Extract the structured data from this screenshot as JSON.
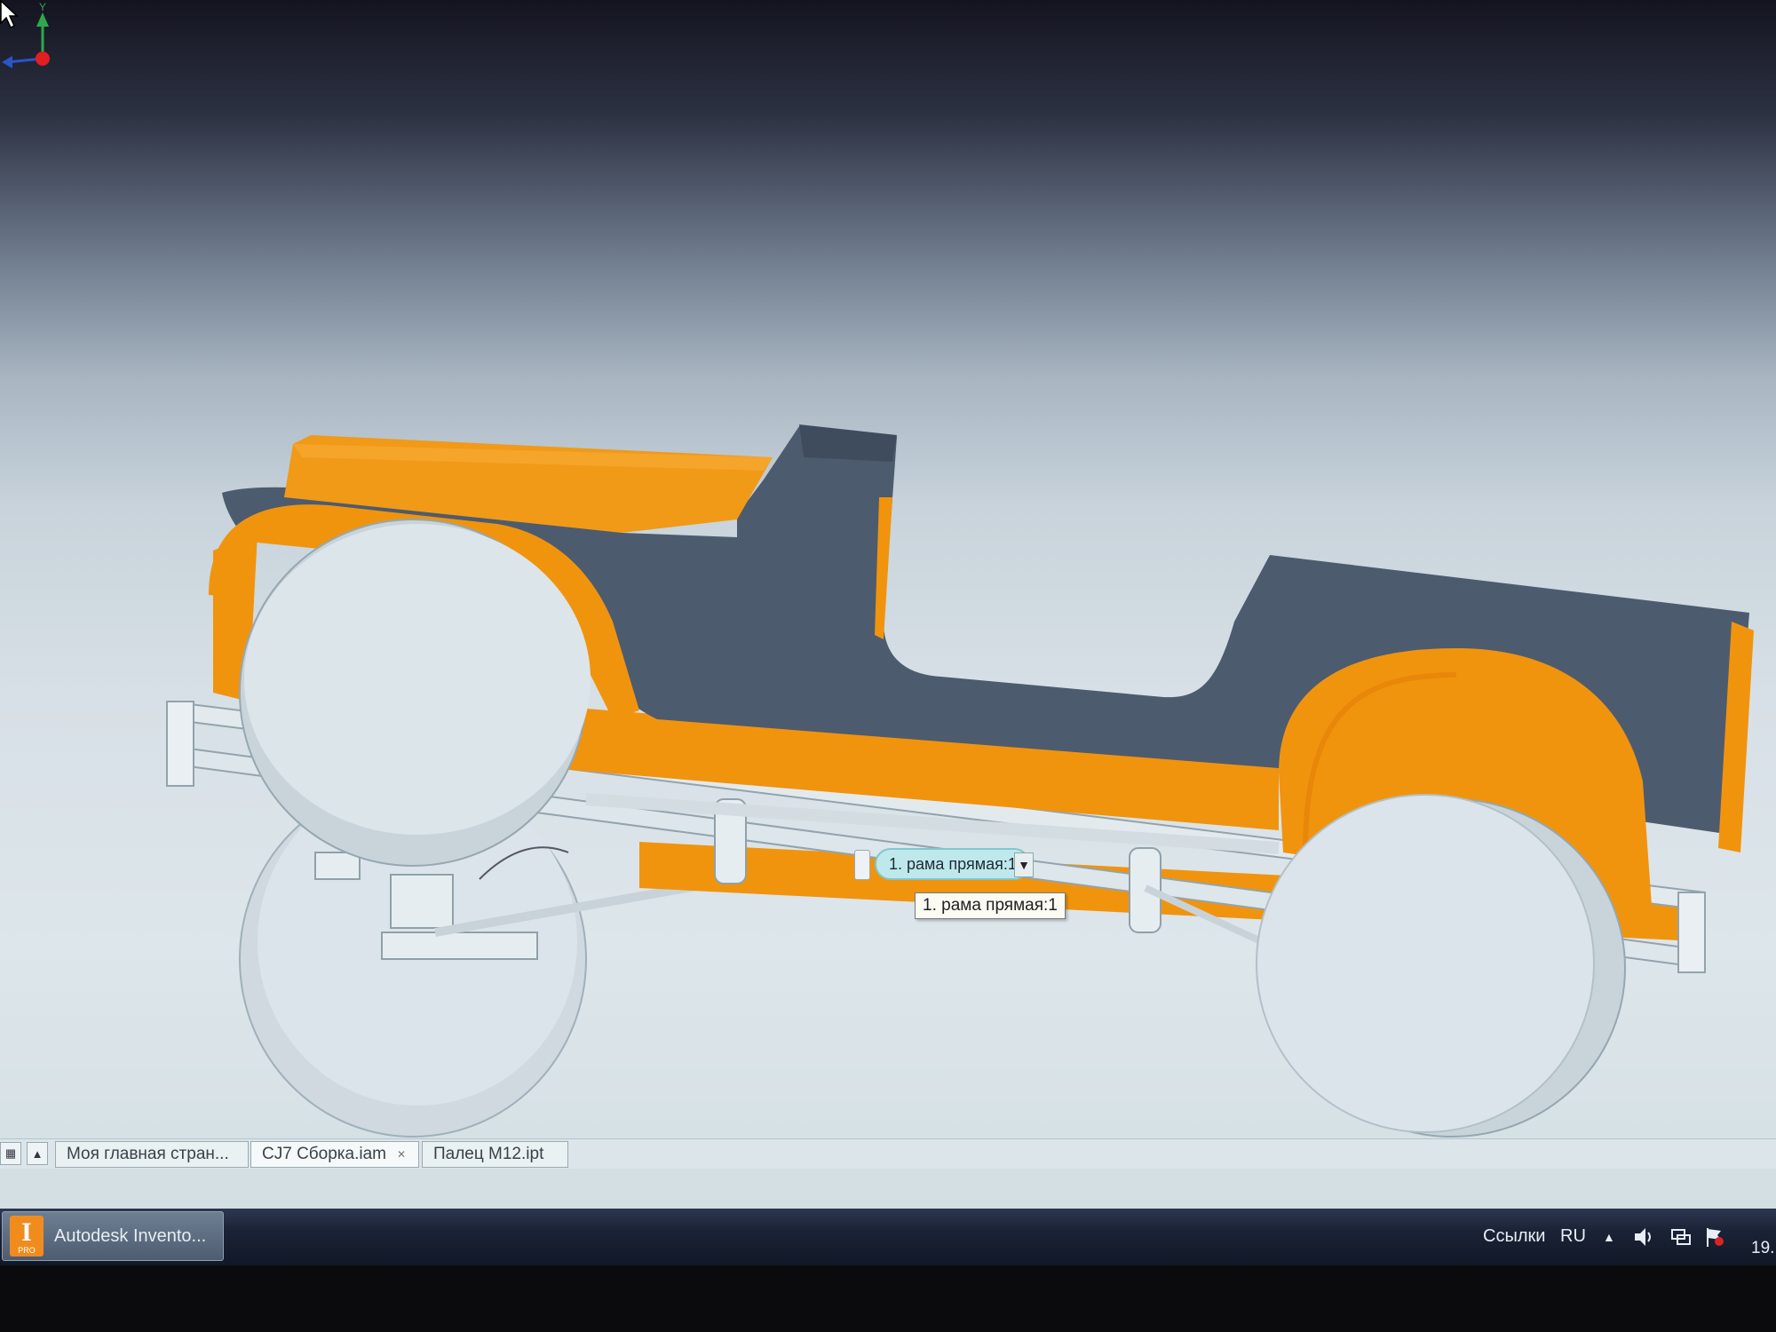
{
  "viewport": {
    "model_name": "CJ7 jeep assembly",
    "selection_pill": "1. рама прямая:1",
    "tooltip": "1. рама прямая:1",
    "triad": {
      "y_label": "Y"
    },
    "colors": {
      "body_orange": "#f0940e",
      "body_gray": "#4d5b6e",
      "wheel_light": "#dbe4ea",
      "frame_light": "#dde6ea"
    }
  },
  "document_tabs": [
    {
      "label": "Моя главная стран..."
    },
    {
      "label": "CJ7 Сборка.iam",
      "close_icon": "close-icon"
    },
    {
      "label": "Палец M12.ipt"
    }
  ],
  "tab_controls": [
    "tile-windows-icon",
    "arrow-up-icon"
  ],
  "taskbar": {
    "app_button": {
      "label": "Autodesk Invento...",
      "icon_letter": "I",
      "icon_edition": "PRO"
    },
    "links_label": "Ссылки",
    "language": "RU",
    "tray_icons": [
      "show-hidden-icons-arrow",
      "volume-icon",
      "network-icon",
      "action-center-flag-icon"
    ],
    "clock": "19."
  }
}
